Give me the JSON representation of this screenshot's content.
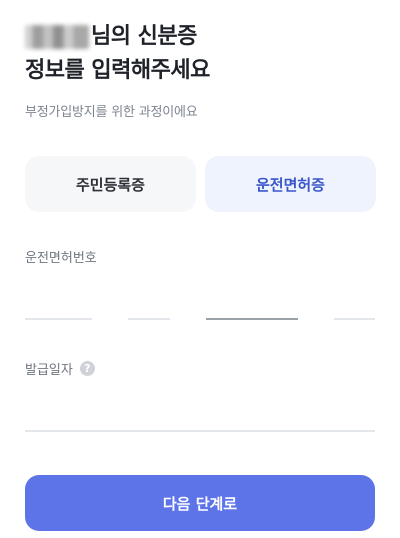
{
  "header": {
    "title_suffix": "님의 신분증",
    "title_line2": "정보를 입력해주세요",
    "subtitle": "부정가입방지를 위한 과정이에요"
  },
  "tabs": [
    {
      "label": "주민등록증",
      "selected": false
    },
    {
      "label": "운전면허증",
      "selected": true
    }
  ],
  "fields": {
    "license_label": "운전면허번호",
    "issue_date_label": "발급일자",
    "help_icon": "?"
  },
  "buttons": {
    "next": "다음 단계로"
  },
  "colors": {
    "primary": "#5d73e8",
    "selected_tab_bg": "#eef3fd",
    "selected_tab_text": "#3a56c9"
  }
}
